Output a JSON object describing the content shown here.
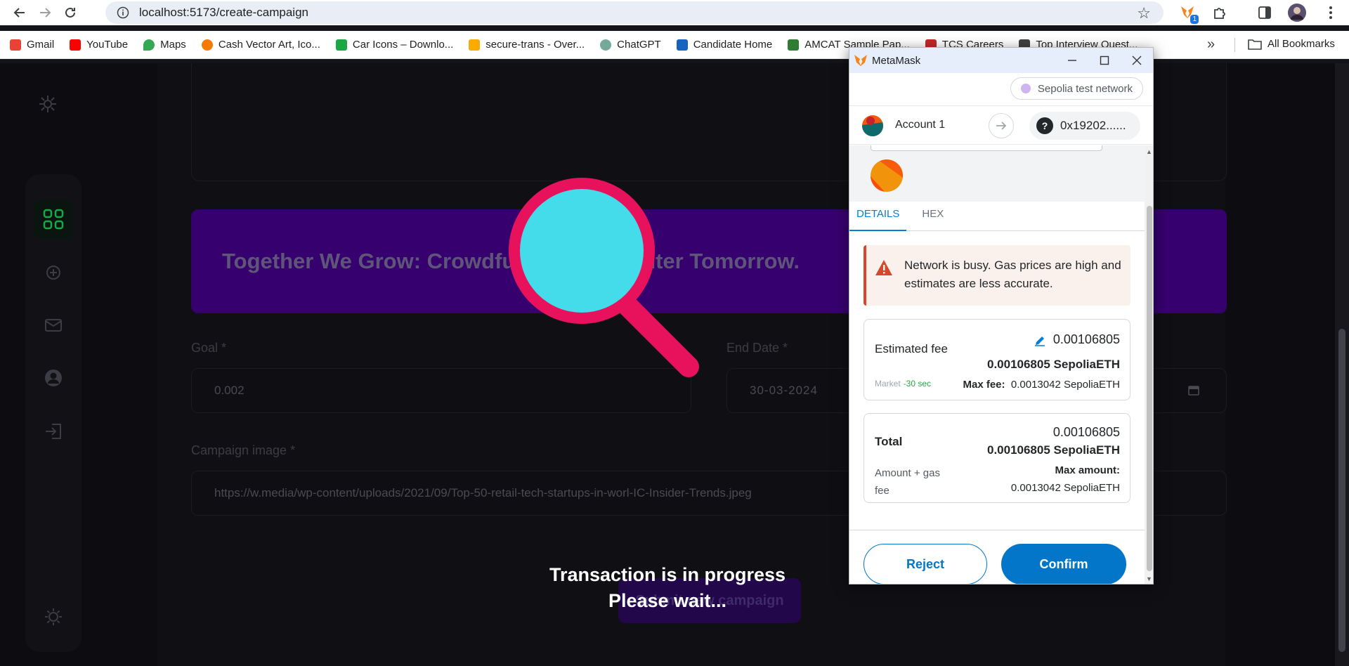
{
  "browser": {
    "url": "localhost:5173/create-campaign",
    "bookmarks": [
      {
        "label": "Gmail",
        "color": "#ea4335"
      },
      {
        "label": "YouTube",
        "color": "#ff0000"
      },
      {
        "label": "Maps",
        "color": "#34a853"
      },
      {
        "label": "Cash Vector Art, Ico...",
        "color": "#f57c00"
      },
      {
        "label": "Car Icons – Downlo...",
        "color": "#1aa843"
      },
      {
        "label": "secure-trans - Over...",
        "color": "#f9ab00"
      },
      {
        "label": "ChatGPT",
        "color": "#74aa9c"
      },
      {
        "label": "Candidate Home",
        "color": "#1565c0"
      },
      {
        "label": "AMCAT Sample Pap...",
        "color": "#2e7d32"
      },
      {
        "label": "TCS Careers",
        "color": "#c62828"
      },
      {
        "label": "Top Interview Quest...",
        "color": "#424242"
      }
    ],
    "all_bookmarks": "All Bookmarks",
    "extension_badge": "1"
  },
  "app": {
    "banner_text": "Together We Grow: Crowdfunding a Brighter Tomorrow.",
    "goal_label": "Goal *",
    "goal_value": "0.002",
    "end_date_label": "End Date *",
    "end_date_value": "30-03-2024",
    "image_label": "Campaign image *",
    "image_value": "https://w.media/wp-content/uploads/2021/09/Top-50-retail-tech-startups-in-worl-IC-Insider-Trends.jpeg",
    "submit_label": "Submit new campaign",
    "progress_line1": "Transaction is in progress",
    "progress_line2": "Please wait..."
  },
  "metamask": {
    "window_title": "MetaMask",
    "network": "Sepolia test network",
    "account_name": "Account 1",
    "address": "0x19202......",
    "tabs": [
      "DETAILS",
      "HEX"
    ],
    "warning": "Network is busy. Gas prices are high and estimates are less accurate.",
    "estimated_fee_label": "Estimated fee",
    "estimated_fee_value": "0.00106805",
    "estimated_fee_eth": "0.00106805 SepoliaETH",
    "market_label": "Market",
    "market_time": "-30 sec",
    "max_fee_label": "Max fee:",
    "max_fee_value": "0.0013042 SepoliaETH",
    "total_label": "Total",
    "total_value": "0.00106805",
    "total_eth": "0.00106805 SepoliaETH",
    "amount_gas_label": "Amount + gas fee",
    "max_amount_label": "Max amount:",
    "max_amount_value": "0.0013042 SepoliaETH",
    "reject_label": "Reject",
    "confirm_label": "Confirm"
  },
  "colors": {
    "banner": "#37006f",
    "loader_ring": "#e8125c",
    "loader_lens": "#44dbea",
    "active_icon": "#17a84a",
    "metamask_blue": "#0376c9"
  }
}
